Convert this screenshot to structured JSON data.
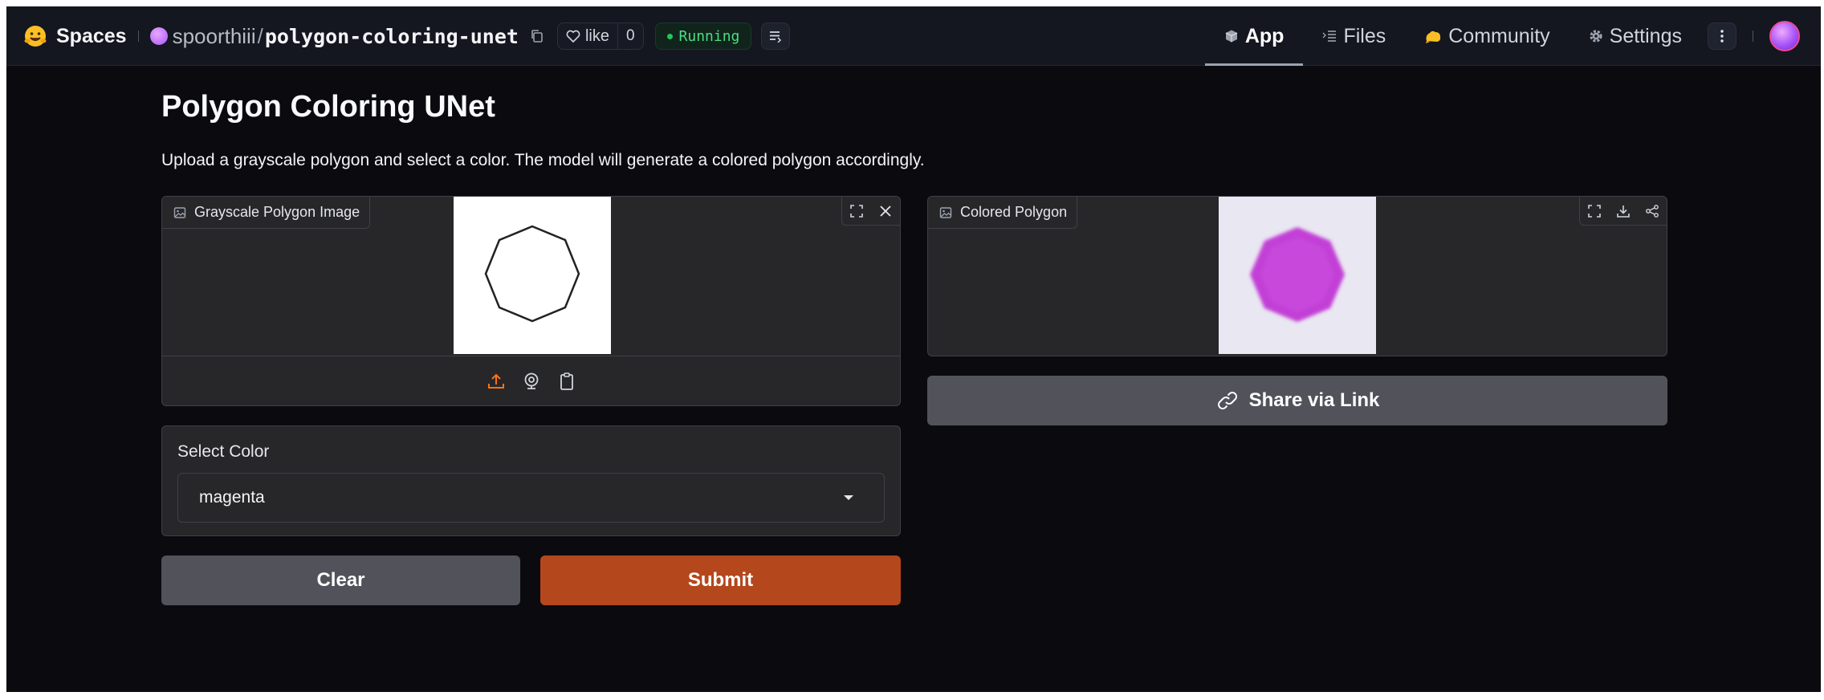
{
  "header": {
    "brand": "Spaces",
    "owner": "spoorthiii",
    "separator": "/",
    "repo": "polygon-coloring-unet",
    "like_label": "like",
    "like_count": "0",
    "status": "Running",
    "nav": [
      {
        "label": "App",
        "icon": "cube-icon",
        "active": true
      },
      {
        "label": "Files",
        "icon": "files-icon",
        "active": false
      },
      {
        "label": "Community",
        "icon": "community-icon",
        "active": false
      },
      {
        "label": "Settings",
        "icon": "gear-icon",
        "active": false
      }
    ]
  },
  "main": {
    "title": "Polygon Coloring UNet",
    "description": "Upload a grayscale polygon and select a color. The model will generate a colored polygon accordingly.",
    "input_image": {
      "label": "Grayscale Polygon Image",
      "shape": "octagon-outline",
      "source_icons": [
        "upload-icon",
        "webcam-icon",
        "clipboard-icon"
      ]
    },
    "output_image": {
      "label": "Colored Polygon",
      "shape": "octagon-filled",
      "fill_color": "#c23fd6"
    },
    "share_label": "Share via Link",
    "color_select": {
      "label": "Select Color",
      "value": "magenta"
    },
    "clear_label": "Clear",
    "submit_label": "Submit"
  },
  "colors": {
    "background": "#0b0b0f",
    "header": "#141620",
    "panel": "#27272a",
    "submit": "#b5471c",
    "secondary_button": "#52525b",
    "running": "#4ade80"
  }
}
